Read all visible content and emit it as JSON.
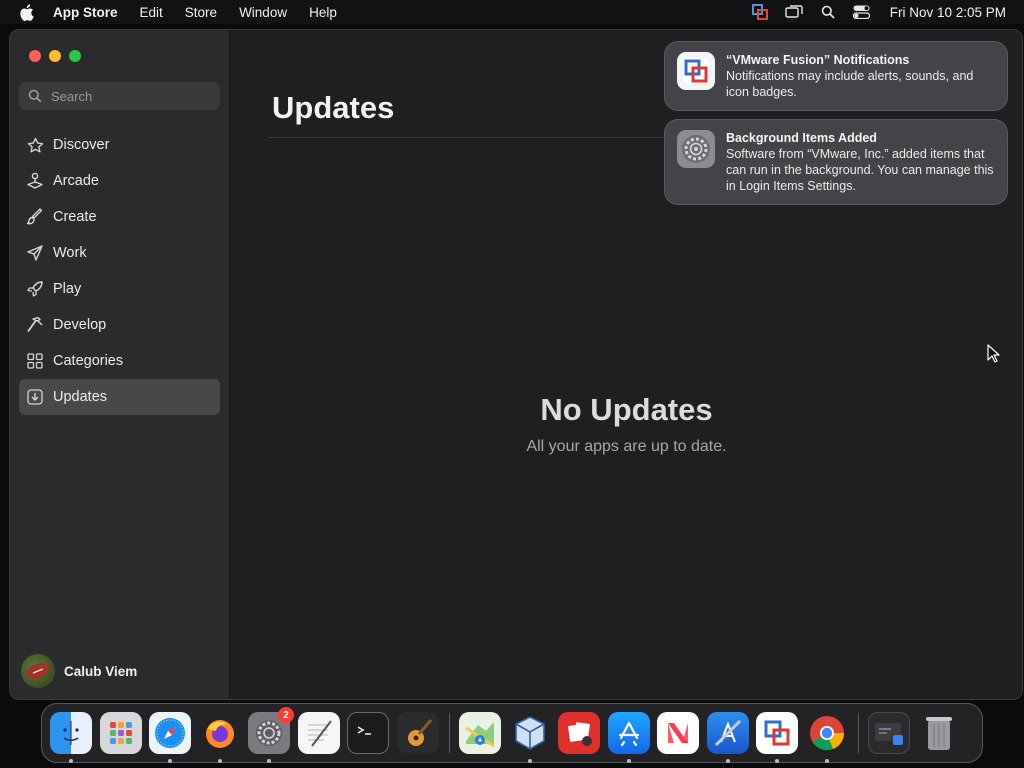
{
  "menubar": {
    "app_name": "App Store",
    "menus": [
      "Edit",
      "Store",
      "Window",
      "Help"
    ],
    "clock": "Fri Nov 10  2:05 PM"
  },
  "sidebar": {
    "search_placeholder": "Search",
    "items": [
      {
        "label": "Discover",
        "icon": "star-icon"
      },
      {
        "label": "Arcade",
        "icon": "joystick-icon"
      },
      {
        "label": "Create",
        "icon": "paintbrush-icon"
      },
      {
        "label": "Work",
        "icon": "paperplane-icon"
      },
      {
        "label": "Play",
        "icon": "rocket-icon"
      },
      {
        "label": "Develop",
        "icon": "hammer-icon"
      },
      {
        "label": "Categories",
        "icon": "grid-icon"
      },
      {
        "label": "Updates",
        "icon": "download-icon",
        "active": true
      }
    ],
    "account_name": "Calub Viem"
  },
  "main": {
    "title": "Updates",
    "empty_title": "No Updates",
    "empty_subtitle": "All your apps are up to date."
  },
  "notifications": [
    {
      "title": "“VMware Fusion” Notifications",
      "body": "Notifications may include alerts, sounds, and icon badges.",
      "icon": "vmware-fusion-icon"
    },
    {
      "title": "Background Items Added",
      "body": "Software from “VMware, Inc.” added items that can run in the background. You can manage this in Login Items Settings.",
      "icon": "system-settings-icon"
    }
  ],
  "dock": {
    "apps": [
      {
        "name": "finder-icon",
        "running": true
      },
      {
        "name": "launchpad-icon",
        "running": false
      },
      {
        "name": "safari-icon",
        "running": true
      },
      {
        "name": "firefox-icon",
        "running": true
      },
      {
        "name": "system-settings-icon",
        "running": true,
        "badge": "2"
      },
      {
        "name": "textedit-icon",
        "running": false
      },
      {
        "name": "terminal-icon",
        "running": false
      },
      {
        "name": "garageband-icon",
        "running": false
      },
      {
        "name": "maps-icon",
        "running": false
      },
      {
        "name": "virtualbox-icon",
        "running": true
      },
      {
        "name": "photo-booth-icon",
        "running": false
      },
      {
        "name": "app-store-icon",
        "running": true
      },
      {
        "name": "news-icon",
        "running": false
      },
      {
        "name": "xcode-icon",
        "running": true
      },
      {
        "name": "vmware-fusion-icon",
        "running": true
      },
      {
        "name": "chrome-icon",
        "running": true
      }
    ],
    "trash": "trash-icon"
  },
  "colors": {
    "window_bg": "#1f1f21",
    "sidebar_bg": "#2b2b2d",
    "selected_item": "#48484b",
    "notification_bg": "#48484c"
  }
}
